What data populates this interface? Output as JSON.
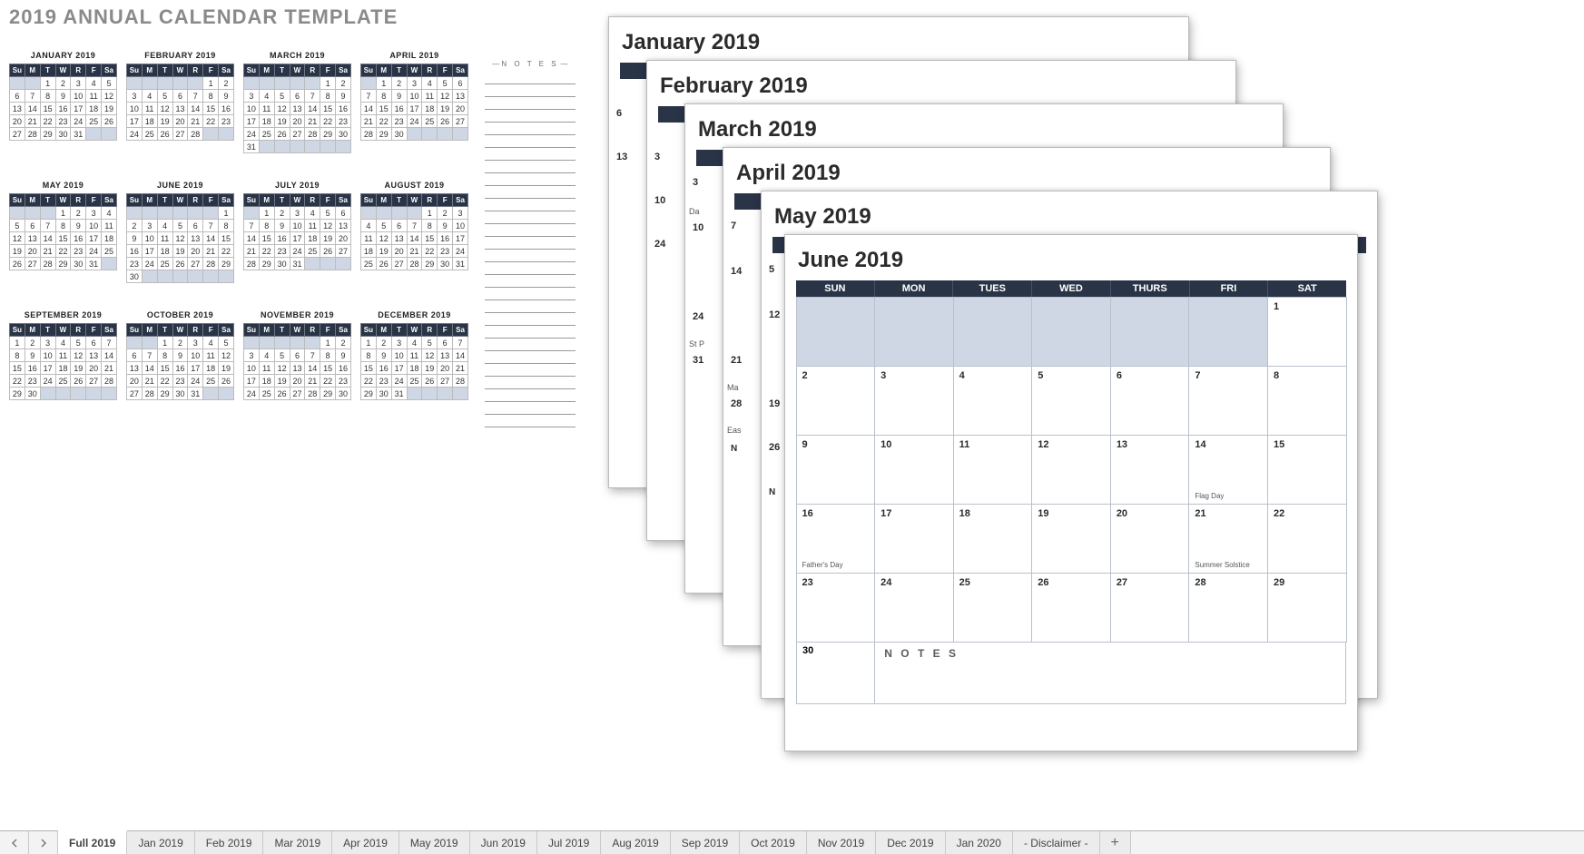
{
  "title": "2019 ANNUAL CALENDAR TEMPLATE",
  "dow": [
    "Su",
    "M",
    "T",
    "W",
    "R",
    "F",
    "Sa"
  ],
  "dow_long": [
    "SUN",
    "MON",
    "TUES",
    "WED",
    "THURS",
    "FRI",
    "SAT"
  ],
  "notes_label": "N O T E S",
  "mini_months": [
    {
      "name": "JANUARY 2019",
      "start": 2,
      "days": 31
    },
    {
      "name": "FEBRUARY 2019",
      "start": 5,
      "days": 28
    },
    {
      "name": "MARCH 2019",
      "start": 5,
      "days": 31
    },
    {
      "name": "APRIL 2019",
      "start": 1,
      "days": 30
    },
    {
      "name": "MAY 2019",
      "start": 3,
      "days": 31
    },
    {
      "name": "JUNE 2019",
      "start": 6,
      "days": 30
    },
    {
      "name": "JULY 2019",
      "start": 1,
      "days": 31
    },
    {
      "name": "AUGUST 2019",
      "start": 4,
      "days": 31
    },
    {
      "name": "SEPTEMBER 2019",
      "start": 0,
      "days": 30
    },
    {
      "name": "OCTOBER 2019",
      "start": 2,
      "days": 31
    },
    {
      "name": "NOVEMBER 2019",
      "start": 5,
      "days": 30
    },
    {
      "name": "DECEMBER 2019",
      "start": 0,
      "days": 31
    }
  ],
  "cards": {
    "jan": {
      "title": "January 2019",
      "edge_nums": [
        "6",
        "13"
      ]
    },
    "feb": {
      "title": "February 2019",
      "edge_nums": [
        "3",
        "10",
        "24"
      ],
      "edge_labels": {
        "0": "",
        "1": "",
        "2": ""
      }
    },
    "mar": {
      "title": "March 2019",
      "edge_nums": [
        "3",
        "10",
        "24",
        "31"
      ],
      "edge_labels": {
        "0": "Da",
        "1": "",
        "2": "St P",
        "3": ""
      }
    },
    "apr": {
      "title": "April 2019",
      "edge_nums": [
        "7",
        "14",
        "21",
        "28"
      ],
      "edge_labels": {
        "0": "",
        "1": "",
        "2": "Ma",
        "3": "Eas"
      },
      "edge_notes": "N"
    },
    "may": {
      "title": "May 2019",
      "edge_nums": [
        "5",
        "12",
        "19",
        "26"
      ],
      "edge_labels": {
        "0": "",
        "1": "",
        "2": "",
        "3": ""
      },
      "edge_notes": "N"
    },
    "jun": {
      "title": "June 2019",
      "start": 6,
      "days": 30,
      "events": {
        "14": "Flag Day",
        "16": "Father's Day",
        "21": "Summer Solstice"
      },
      "last_row_day": "30",
      "notes_label": "N O T E S"
    }
  },
  "tabs": [
    "Full 2019",
    "Jan 2019",
    "Feb 2019",
    "Mar 2019",
    "Apr 2019",
    "May 2019",
    "Jun 2019",
    "Jul 2019",
    "Aug 2019",
    "Sep 2019",
    "Oct 2019",
    "Nov 2019",
    "Dec 2019",
    "Jan 2020",
    "- Disclaimer -"
  ],
  "active_tab": "Full 2019"
}
